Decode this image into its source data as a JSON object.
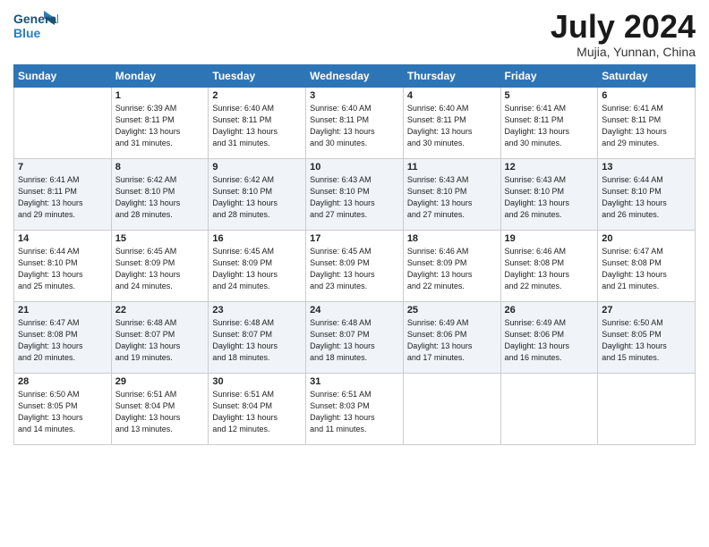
{
  "logo": {
    "line1": "General",
    "line2": "Blue"
  },
  "title": "July 2024",
  "subtitle": "Mujia, Yunnan, China",
  "header_days": [
    "Sunday",
    "Monday",
    "Tuesday",
    "Wednesday",
    "Thursday",
    "Friday",
    "Saturday"
  ],
  "weeks": [
    [
      {
        "day": "",
        "info": ""
      },
      {
        "day": "1",
        "info": "Sunrise: 6:39 AM\nSunset: 8:11 PM\nDaylight: 13 hours\nand 31 minutes."
      },
      {
        "day": "2",
        "info": "Sunrise: 6:40 AM\nSunset: 8:11 PM\nDaylight: 13 hours\nand 31 minutes."
      },
      {
        "day": "3",
        "info": "Sunrise: 6:40 AM\nSunset: 8:11 PM\nDaylight: 13 hours\nand 30 minutes."
      },
      {
        "day": "4",
        "info": "Sunrise: 6:40 AM\nSunset: 8:11 PM\nDaylight: 13 hours\nand 30 minutes."
      },
      {
        "day": "5",
        "info": "Sunrise: 6:41 AM\nSunset: 8:11 PM\nDaylight: 13 hours\nand 30 minutes."
      },
      {
        "day": "6",
        "info": "Sunrise: 6:41 AM\nSunset: 8:11 PM\nDaylight: 13 hours\nand 29 minutes."
      }
    ],
    [
      {
        "day": "7",
        "info": "Sunrise: 6:41 AM\nSunset: 8:11 PM\nDaylight: 13 hours\nand 29 minutes."
      },
      {
        "day": "8",
        "info": "Sunrise: 6:42 AM\nSunset: 8:10 PM\nDaylight: 13 hours\nand 28 minutes."
      },
      {
        "day": "9",
        "info": "Sunrise: 6:42 AM\nSunset: 8:10 PM\nDaylight: 13 hours\nand 28 minutes."
      },
      {
        "day": "10",
        "info": "Sunrise: 6:43 AM\nSunset: 8:10 PM\nDaylight: 13 hours\nand 27 minutes."
      },
      {
        "day": "11",
        "info": "Sunrise: 6:43 AM\nSunset: 8:10 PM\nDaylight: 13 hours\nand 27 minutes."
      },
      {
        "day": "12",
        "info": "Sunrise: 6:43 AM\nSunset: 8:10 PM\nDaylight: 13 hours\nand 26 minutes."
      },
      {
        "day": "13",
        "info": "Sunrise: 6:44 AM\nSunset: 8:10 PM\nDaylight: 13 hours\nand 26 minutes."
      }
    ],
    [
      {
        "day": "14",
        "info": "Sunrise: 6:44 AM\nSunset: 8:10 PM\nDaylight: 13 hours\nand 25 minutes."
      },
      {
        "day": "15",
        "info": "Sunrise: 6:45 AM\nSunset: 8:09 PM\nDaylight: 13 hours\nand 24 minutes."
      },
      {
        "day": "16",
        "info": "Sunrise: 6:45 AM\nSunset: 8:09 PM\nDaylight: 13 hours\nand 24 minutes."
      },
      {
        "day": "17",
        "info": "Sunrise: 6:45 AM\nSunset: 8:09 PM\nDaylight: 13 hours\nand 23 minutes."
      },
      {
        "day": "18",
        "info": "Sunrise: 6:46 AM\nSunset: 8:09 PM\nDaylight: 13 hours\nand 22 minutes."
      },
      {
        "day": "19",
        "info": "Sunrise: 6:46 AM\nSunset: 8:08 PM\nDaylight: 13 hours\nand 22 minutes."
      },
      {
        "day": "20",
        "info": "Sunrise: 6:47 AM\nSunset: 8:08 PM\nDaylight: 13 hours\nand 21 minutes."
      }
    ],
    [
      {
        "day": "21",
        "info": "Sunrise: 6:47 AM\nSunset: 8:08 PM\nDaylight: 13 hours\nand 20 minutes."
      },
      {
        "day": "22",
        "info": "Sunrise: 6:48 AM\nSunset: 8:07 PM\nDaylight: 13 hours\nand 19 minutes."
      },
      {
        "day": "23",
        "info": "Sunrise: 6:48 AM\nSunset: 8:07 PM\nDaylight: 13 hours\nand 18 minutes."
      },
      {
        "day": "24",
        "info": "Sunrise: 6:48 AM\nSunset: 8:07 PM\nDaylight: 13 hours\nand 18 minutes."
      },
      {
        "day": "25",
        "info": "Sunrise: 6:49 AM\nSunset: 8:06 PM\nDaylight: 13 hours\nand 17 minutes."
      },
      {
        "day": "26",
        "info": "Sunrise: 6:49 AM\nSunset: 8:06 PM\nDaylight: 13 hours\nand 16 minutes."
      },
      {
        "day": "27",
        "info": "Sunrise: 6:50 AM\nSunset: 8:05 PM\nDaylight: 13 hours\nand 15 minutes."
      }
    ],
    [
      {
        "day": "28",
        "info": "Sunrise: 6:50 AM\nSunset: 8:05 PM\nDaylight: 13 hours\nand 14 minutes."
      },
      {
        "day": "29",
        "info": "Sunrise: 6:51 AM\nSunset: 8:04 PM\nDaylight: 13 hours\nand 13 minutes."
      },
      {
        "day": "30",
        "info": "Sunrise: 6:51 AM\nSunset: 8:04 PM\nDaylight: 13 hours\nand 12 minutes."
      },
      {
        "day": "31",
        "info": "Sunrise: 6:51 AM\nSunset: 8:03 PM\nDaylight: 13 hours\nand 11 minutes."
      },
      {
        "day": "",
        "info": ""
      },
      {
        "day": "",
        "info": ""
      },
      {
        "day": "",
        "info": ""
      }
    ]
  ]
}
